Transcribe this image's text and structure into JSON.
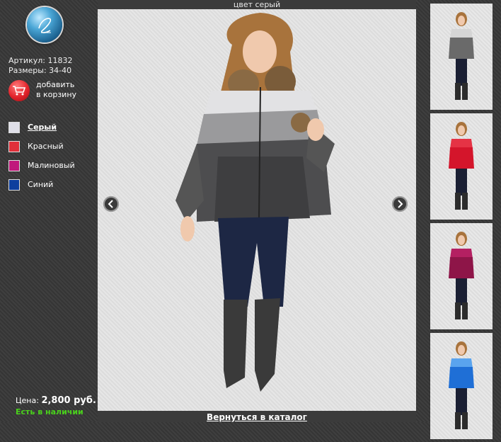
{
  "caption": "цвет серый",
  "back_link": "Вернуться в каталог",
  "product": {
    "article": "Артикул: 11832",
    "sizes": "Размеры: 34-40",
    "cart_line1": "добавить",
    "cart_line2": "в корзину",
    "price_label": "Цена:",
    "price_value": "2,800 руб.",
    "stock": "Есть в наличии"
  },
  "colors": [
    {
      "name": "Серый",
      "hex": "#dfdfe8",
      "active": true
    },
    {
      "name": "Красный",
      "hex": "#e0303a",
      "active": false
    },
    {
      "name": "Малиновый",
      "hex": "#c0187c",
      "active": false
    },
    {
      "name": "Синий",
      "hex": "#0d3f9e",
      "active": false
    }
  ],
  "thumbnails": [
    {
      "jacket": "#6a6a6a",
      "jacket_top": "#d5d5d5",
      "color": "grey"
    },
    {
      "jacket": "#d4152b",
      "jacket_top": "#e53345",
      "color": "red"
    },
    {
      "jacket": "#8e1548",
      "jacket_top": "#b42062",
      "color": "raspberry"
    },
    {
      "jacket": "#1f6fd6",
      "jacket_top": "#5aa4ee",
      "color": "blue"
    }
  ],
  "icons": {
    "logo": "logo-icon",
    "cart": "cart-icon",
    "prev": "chevron-left-icon",
    "next": "chevron-right-icon"
  }
}
